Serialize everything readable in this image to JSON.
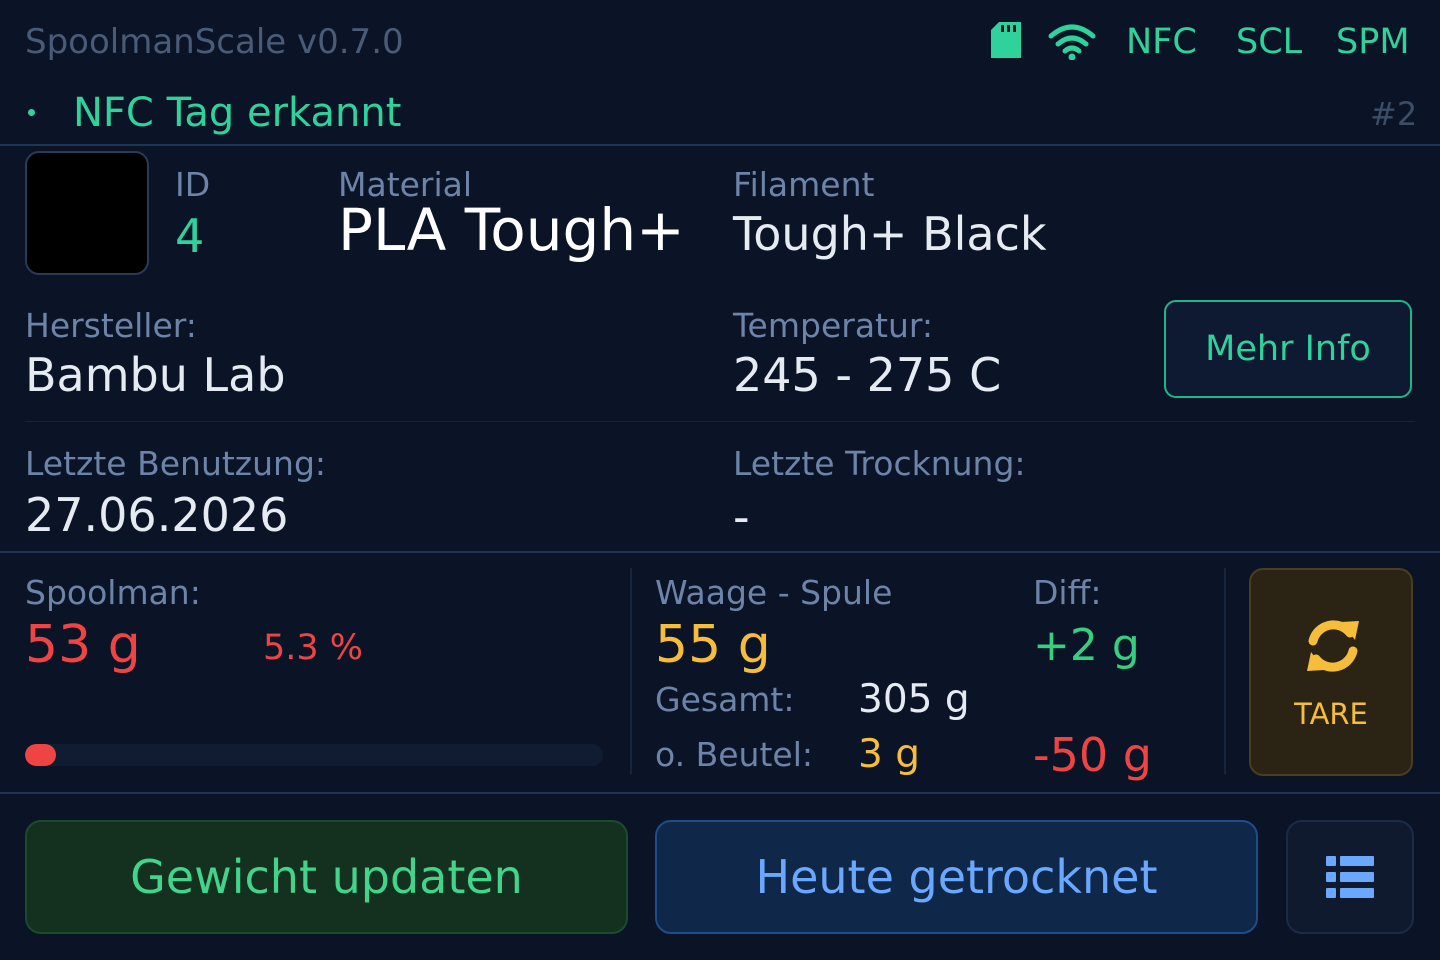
{
  "header": {
    "title": "SpoolmanScale v0.7.0",
    "tags": [
      "NFC",
      "SCL",
      "SPM"
    ],
    "status_text": "NFC Tag erkannt",
    "scale_number": "#2",
    "accent_color": "#2fd29a",
    "icons": [
      "sd-card-icon",
      "wifi-icon"
    ]
  },
  "spool": {
    "swatch_color": "#000000",
    "id_label": "ID",
    "id_value": "4",
    "material_label": "Material",
    "material_value": "PLA Tough+",
    "filament_label": "Filament",
    "filament_value": "Tough+ Black",
    "vendor_label": "Hersteller:",
    "vendor_value": "Bambu Lab",
    "temp_label": "Temperatur:",
    "temp_value": "245 - 275 C",
    "more_info_label": "Mehr Info",
    "last_used_label": "Letzte Benutzung:",
    "last_used_value": "27.06.2026",
    "last_dried_label": "Letzte Trocknung:",
    "last_dried_value": "-"
  },
  "weights": {
    "spoolman_label": "Spoolman:",
    "spoolman_value": "53 g",
    "spoolman_percent": "5.3 %",
    "spoolman_fraction": 0.053,
    "scale_label": "Waage - Spule",
    "scale_value": "55 g",
    "diff_label": "Diff:",
    "diff_value": "+2 g",
    "total_label": "Gesamt:",
    "total_value": "305 g",
    "no_bag_label": "o. Beutel:",
    "no_bag_value": "3 g",
    "no_bag_diff": "-50 g",
    "tare_label": "TARE",
    "colors": {
      "low": "#ef4444",
      "scale": "#f5bd3a",
      "positive": "#35d07f"
    }
  },
  "actions": {
    "update_label": "Gewicht updaten",
    "dried_label": "Heute getrocknet",
    "menu_icon": "list-icon"
  }
}
